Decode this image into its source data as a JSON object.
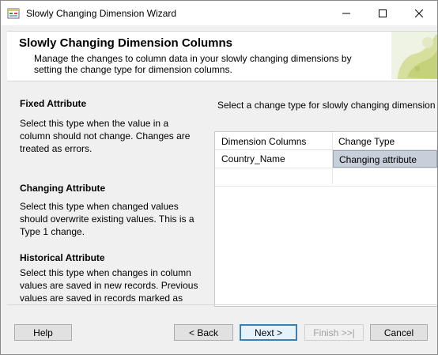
{
  "window": {
    "title": "Slowly Changing Dimension Wizard",
    "icons": [
      "app-icon",
      "minimize-icon",
      "maximize-icon",
      "close-icon"
    ]
  },
  "header": {
    "title": "Slowly Changing Dimension Columns",
    "description": "Manage the changes to column data in your slowly changing dimensions by setting the change type for dimension columns."
  },
  "sidebar": {
    "sections": [
      {
        "title": "Fixed Attribute",
        "description": "Select this type when the value in a column should not change. Changes are treated as errors."
      },
      {
        "title": "Changing Attribute",
        "description": "Select this type when changed values should overwrite existing values. This is a Type 1 change."
      },
      {
        "title": "Historical Attribute",
        "description": "Select this type when changes in column values are saved in new records. Previous values are saved in records marked as"
      }
    ]
  },
  "main": {
    "instruction": "Select a change type for slowly changing dimension",
    "grid": {
      "columns": [
        "Dimension Columns",
        "Change Type"
      ],
      "rows": [
        {
          "dimension_column": "Country_Name",
          "change_type": "Changing attribute",
          "selected": true
        }
      ]
    }
  },
  "buttons": {
    "help": "Help",
    "back": "< Back",
    "next": "Next >",
    "finish": "Finish >>|",
    "cancel": "Cancel"
  },
  "colors": {
    "selected_cell": "#c6cfda",
    "default_button_border": "#3c7fb1",
    "disabled_text": "#a0a0a0"
  }
}
